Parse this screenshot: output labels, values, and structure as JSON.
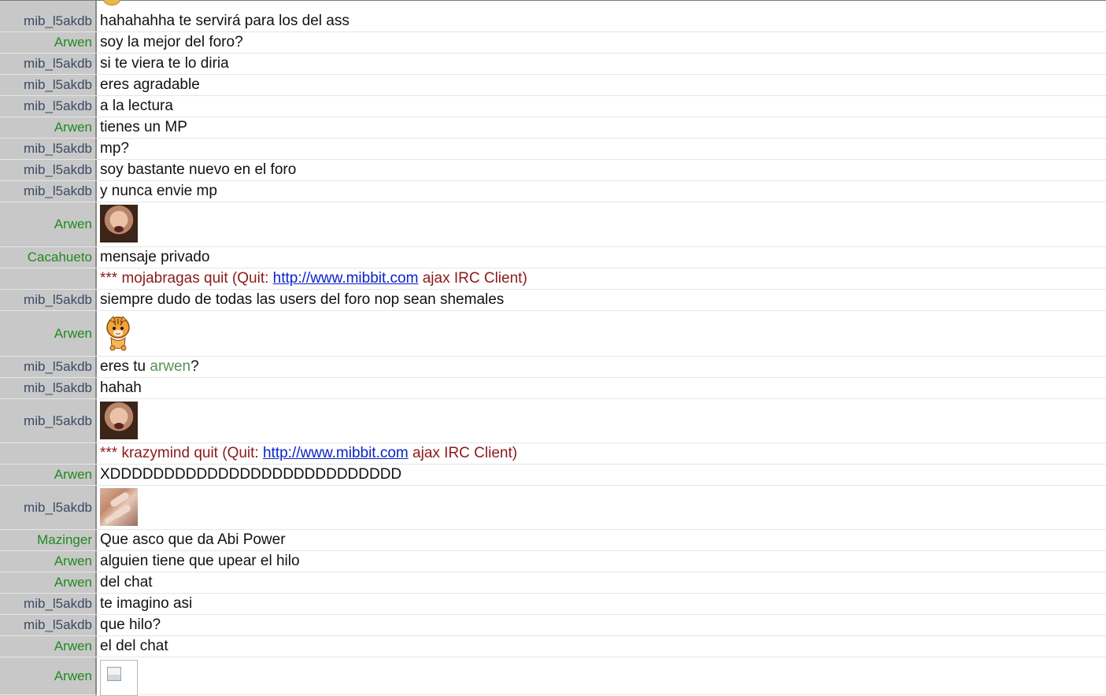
{
  "chat": {
    "rows": [
      {
        "nick": "mib_l5akdb",
        "text": "hahahahha te servirá para los del ass"
      },
      {
        "nick": "Arwen",
        "text": "soy la mejor del foro?"
      },
      {
        "nick": "mib_l5akdb",
        "text": "si te viera te lo diria"
      },
      {
        "nick": "mib_l5akdb",
        "text": "eres agradable"
      },
      {
        "nick": "mib_l5akdb",
        "text": "a la lectura"
      },
      {
        "nick": "Arwen",
        "text": "tienes un MP"
      },
      {
        "nick": "mib_l5akdb",
        "text": "mp?"
      },
      {
        "nick": "mib_l5akdb",
        "text": "soy bastante nuevo en el foro"
      },
      {
        "nick": "mib_l5akdb",
        "text": "y nunca envie mp"
      },
      {
        "nick": "Arwen",
        "image": "face-thumbnail"
      },
      {
        "nick": "Cacahueto",
        "text": "mensaje privado"
      },
      {
        "system": {
          "stars": "***",
          "text_before": "mojabragas quit (Quit:",
          "link": "http://www.mibbit.com",
          "text_after": "ajax IRC Client)"
        }
      },
      {
        "nick": "mib_l5akdb",
        "text": "siempre dudo de todas las users del foro nop sean shemales"
      },
      {
        "nick": "Arwen",
        "image": "tiger-sticker"
      },
      {
        "nick": "mib_l5akdb",
        "text_before": "eres tu",
        "mention": "arwen",
        "text_after": "?"
      },
      {
        "nick": "mib_l5akdb",
        "text": "hahah"
      },
      {
        "nick": "mib_l5akdb",
        "image": "face-thumbnail"
      },
      {
        "system": {
          "stars": "***",
          "text_before": "krazymind quit (Quit:",
          "link": "http://www.mibbit.com",
          "text_after": "ajax IRC Client)"
        }
      },
      {
        "nick": "Arwen",
        "text": "XDDDDDDDDDDDDDDDDDDDDDDDDDDD"
      },
      {
        "nick": "mib_l5akdb",
        "image": "hand-thumbnail"
      },
      {
        "nick": "Mazinger",
        "text": "Que asco que da Abi Power"
      },
      {
        "nick": "Arwen",
        "text": "alguien tiene que upear el hilo"
      },
      {
        "nick": "Arwen",
        "text": "del chat"
      },
      {
        "nick": "mib_l5akdb",
        "text": "te imagino asi"
      },
      {
        "nick": "mib_l5akdb",
        "text": "que hilo?"
      },
      {
        "nick": "Arwen",
        "text": "el del chat"
      },
      {
        "nick": "Arwen",
        "image": "broken-image-icon"
      }
    ]
  },
  "colors": {
    "gutter": "#c8c8c8",
    "nick_default": "#3a4a64",
    "nick_other": "#1f8a1f",
    "system_text": "#8b1a1a",
    "link": "#0b23c8",
    "mention": "#5b8f5b"
  }
}
